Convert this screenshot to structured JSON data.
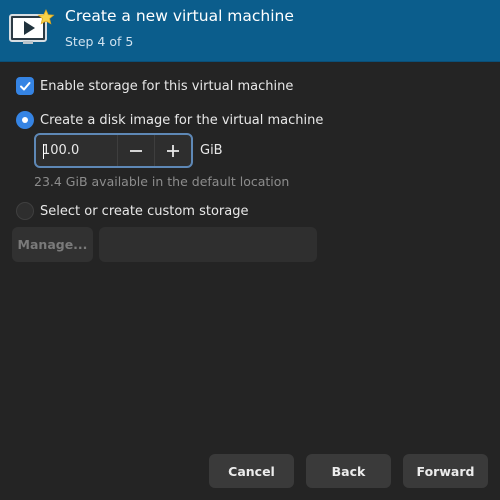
{
  "header": {
    "title": "Create a new virtual machine",
    "step": "Step 4 of 5",
    "icon": "monitor-play-icon",
    "bg_color": "#0b5d8c"
  },
  "storage": {
    "enable_label": "Enable storage for this virtual machine",
    "enable_checked": true,
    "create_disk_label": "Create a disk image for the virtual machine",
    "create_disk_selected": true,
    "size_value": "100.0",
    "size_unit": "GiB",
    "available_text": "23.4 GiB available in the default location",
    "custom_label": "Select or create custom storage",
    "custom_selected": false,
    "manage_label": "Manage...",
    "custom_path_value": ""
  },
  "footer": {
    "cancel_label": "Cancel",
    "back_label": "Back",
    "forward_label": "Forward"
  },
  "colors": {
    "accent": "#3584e4",
    "background": "#242424"
  }
}
